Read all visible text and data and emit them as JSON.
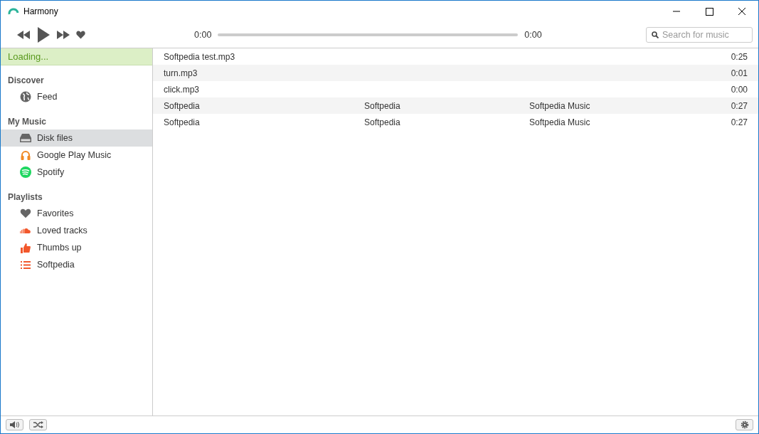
{
  "window": {
    "title": "Harmony"
  },
  "player": {
    "time_elapsed": "0:00",
    "time_total": "0:00",
    "search": {
      "placeholder": "Search for music"
    }
  },
  "sidebar": {
    "status": "Loading...",
    "sections": [
      {
        "title": "Discover",
        "items": [
          {
            "label": "Feed",
            "kind": "globe",
            "selected": false
          }
        ]
      },
      {
        "title": "My Music",
        "items": [
          {
            "label": "Disk files",
            "kind": "disk",
            "selected": true
          },
          {
            "label": "Google Play Music",
            "kind": "headphones",
            "selected": false
          },
          {
            "label": "Spotify",
            "kind": "spotify",
            "selected": false
          }
        ]
      },
      {
        "title": "Playlists",
        "items": [
          {
            "label": "Favorites",
            "kind": "heart",
            "selected": false
          },
          {
            "label": "Loved tracks",
            "kind": "cloud",
            "selected": false
          },
          {
            "label": "Thumbs up",
            "kind": "thumb",
            "selected": false
          },
          {
            "label": "Softpedia",
            "kind": "list",
            "selected": false
          }
        ]
      }
    ]
  },
  "tracks": [
    {
      "title": "Softpedia test.mp3",
      "duration": "0:25"
    },
    {
      "title": "turn.mp3",
      "duration": "0:01"
    },
    {
      "title": "click.mp3",
      "duration": "0:00"
    },
    {
      "title": "Softpedia",
      "column_2": "Softpedia",
      "column_3": "Softpedia Music",
      "duration": "0:27"
    },
    {
      "title": "Softpedia",
      "column_2": "Softpedia",
      "column_3": "Softpedia Music",
      "duration": "0:27"
    }
  ]
}
